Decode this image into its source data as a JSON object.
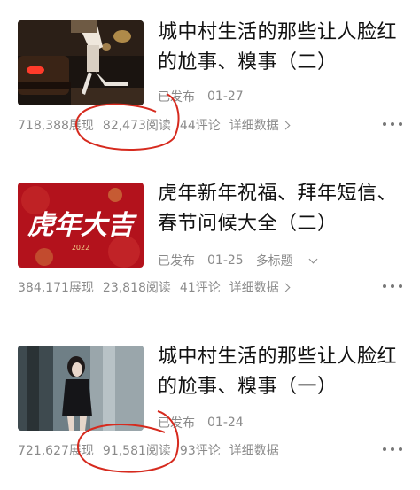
{
  "articles": [
    {
      "title": "城中村生活的那些让人脸红的尬事、糗事（二）",
      "status": "已发布",
      "date": "01-27",
      "multi_title": "",
      "impressions": "718,388展现",
      "reads": "82,473阅读",
      "comments": "44评论",
      "detail": "详细数据"
    },
    {
      "title": "虎年新年祝福、拜年短信、春节问候大全（二）",
      "status": "已发布",
      "date": "01-25",
      "multi_title": "多标题",
      "impressions": "384,171展现",
      "reads": "23,818阅读",
      "comments": "41评论",
      "detail": "详细数据",
      "thumb_text": "虎年大吉",
      "thumb_year": "2022"
    },
    {
      "title": "城中村生活的那些让人脸红的尬事、糗事（一）",
      "status": "已发布",
      "date": "01-24",
      "multi_title": "",
      "impressions": "721,627展现",
      "reads": "91,581阅读",
      "comments": "93评论",
      "detail": "详细数据"
    }
  ],
  "icons": {
    "more": "more-dots-icon",
    "chevron_right": "chevron-right-icon",
    "chevron_down": "chevron-down-icon"
  },
  "colors": {
    "annotation_red": "#d62a1e",
    "thumb2_red": "#b3121c",
    "text_primary": "#111111",
    "text_secondary": "#8a8a8a"
  }
}
